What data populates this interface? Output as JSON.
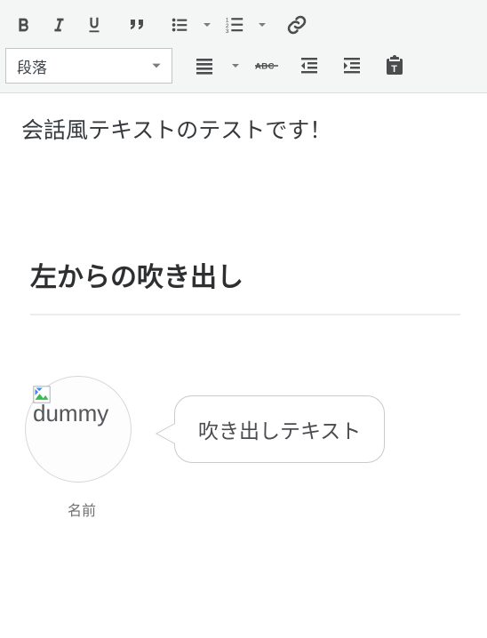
{
  "toolbar": {
    "format_label": "段落"
  },
  "content": {
    "intro": "会話風テキストのテストです！",
    "heading": "左からの吹き出し",
    "avatar_alt": "dummy",
    "avatar_name": "名前",
    "bubble_text": "吹き出しテキスト"
  }
}
